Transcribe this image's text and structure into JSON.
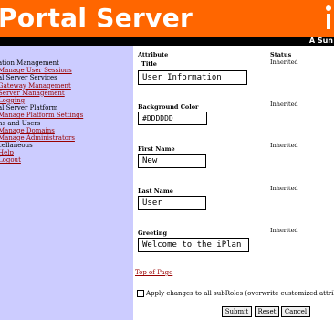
{
  "header": {
    "title": "Portal Server",
    "tagline": "A Sun",
    "logo_icon": "iplanet-logo-icon"
  },
  "sidebar": {
    "items": [
      {
        "label": "ation Management",
        "type": "heading"
      },
      {
        "label": "Manage User Sessions",
        "type": "link"
      },
      {
        "label": "al Server Services",
        "type": "heading"
      },
      {
        "label": "Gateway Management",
        "type": "link"
      },
      {
        "label": "Server Management",
        "type": "link"
      },
      {
        "label": "Logging",
        "type": "link"
      },
      {
        "label": "al Server Platform",
        "type": "heading"
      },
      {
        "label": "Manage Platform Settings",
        "type": "link"
      },
      {
        "label": "ns and Users",
        "type": "heading"
      },
      {
        "label": "Manage Domains",
        "type": "link"
      },
      {
        "label": "Manage Administrators",
        "type": "link"
      },
      {
        "label": "cellaneous",
        "type": "heading"
      },
      {
        "label": "Help",
        "type": "link"
      },
      {
        "label": "Logout",
        "type": "link"
      }
    ]
  },
  "main": {
    "attribute_header": "Attribute",
    "status_header": "Status",
    "attributes": [
      {
        "label": "Title",
        "value": "User Information",
        "status": "Inherited"
      },
      {
        "label": "Background Color",
        "value": "#DDDDDD",
        "status": "Inherited"
      },
      {
        "label": "First Name",
        "value": "New",
        "status": "Inherited"
      },
      {
        "label": "Last Name",
        "value": "User",
        "status": "Inherited"
      },
      {
        "label": "Greeting",
        "value": "Welcome to the iPlan",
        "status": "Inherited"
      }
    ],
    "top_link": "Top of Page",
    "apply_checkbox_label": "Apply changes to all subRoles (overwrite customized attribut",
    "buttons": {
      "submit": "Submit",
      "reset": "Reset",
      "cancel": "Cancel"
    }
  },
  "colors": {
    "header_bg": "#ff6600",
    "sidebar_bg": "#ccccff",
    "link": "#990000"
  }
}
